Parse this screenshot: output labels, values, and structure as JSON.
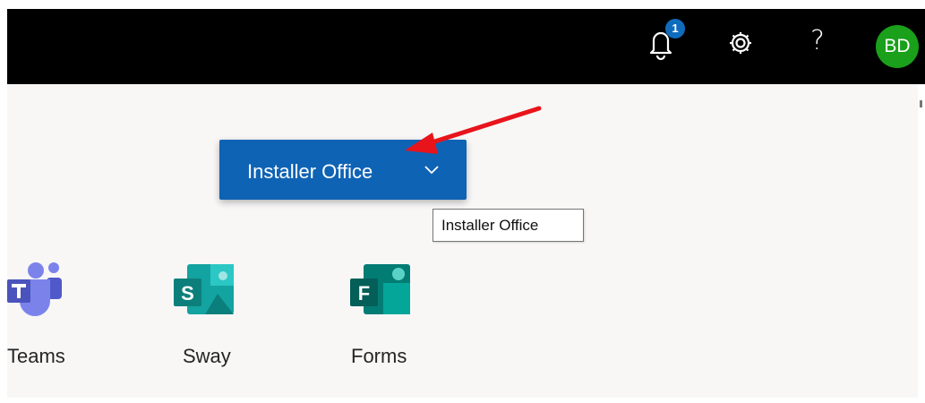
{
  "header": {
    "notification_count": "1",
    "help_glyph": "?",
    "avatar_initials": "BD",
    "avatar_color": "#1aa01a",
    "icons": [
      "bell-icon",
      "gear-icon",
      "help-icon"
    ]
  },
  "install_button": {
    "label": "Installer Office",
    "icon": "chevron-down-icon",
    "color": "#0f63b5"
  },
  "tooltip": {
    "text": "Installer Office"
  },
  "annotation": {
    "icon": "red-arrow-icon",
    "color": "#e8141b"
  },
  "apps": [
    {
      "label": "Teams",
      "icon": "teams-icon"
    },
    {
      "label": "Sway",
      "icon": "sway-icon"
    },
    {
      "label": "Forms",
      "icon": "forms-icon"
    }
  ]
}
